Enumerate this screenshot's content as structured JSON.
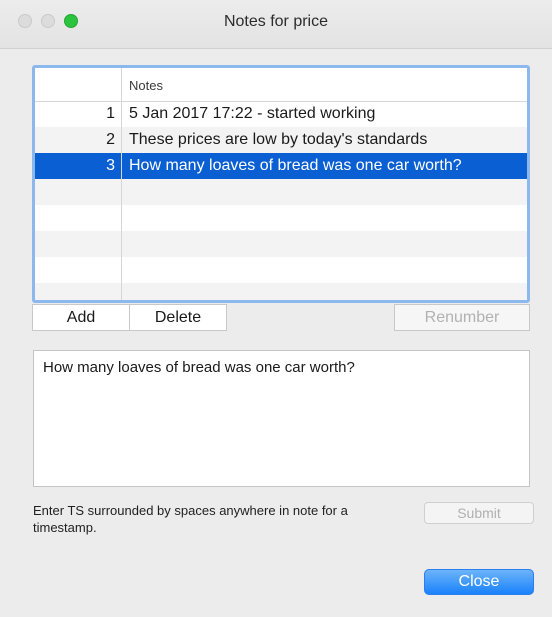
{
  "window": {
    "title": "Notes for price"
  },
  "table": {
    "header": {
      "index": "",
      "notes": "Notes"
    },
    "rows": [
      {
        "num": "1",
        "note": "5 Jan 2017 17:22 - started working",
        "selected": false
      },
      {
        "num": "2",
        "note": "These prices are low by today's standards",
        "selected": false
      },
      {
        "num": "3",
        "note": "How many loaves of bread was one car worth?",
        "selected": true
      },
      {
        "num": "",
        "note": "",
        "selected": false
      },
      {
        "num": "",
        "note": "",
        "selected": false
      },
      {
        "num": "",
        "note": "",
        "selected": false
      },
      {
        "num": "",
        "note": "",
        "selected": false
      },
      {
        "num": "",
        "note": "",
        "selected": false
      },
      {
        "num": "",
        "note": "",
        "selected": false
      },
      {
        "num": "",
        "note": "",
        "selected": false
      }
    ],
    "selected_color": "#0a5fd3",
    "focus_color": "#8db8ee"
  },
  "buttons": {
    "add": "Add",
    "delete": "Delete",
    "renumber": "Renumber"
  },
  "editor": {
    "text": "How many loaves of bread was one car worth?"
  },
  "hint": "Enter TS surrounded by spaces anywhere in note for a timestamp.",
  "submit": "Submit",
  "close": "Close",
  "colors": {
    "accent": "#1a82fb",
    "zoom": "#2cc33e"
  }
}
